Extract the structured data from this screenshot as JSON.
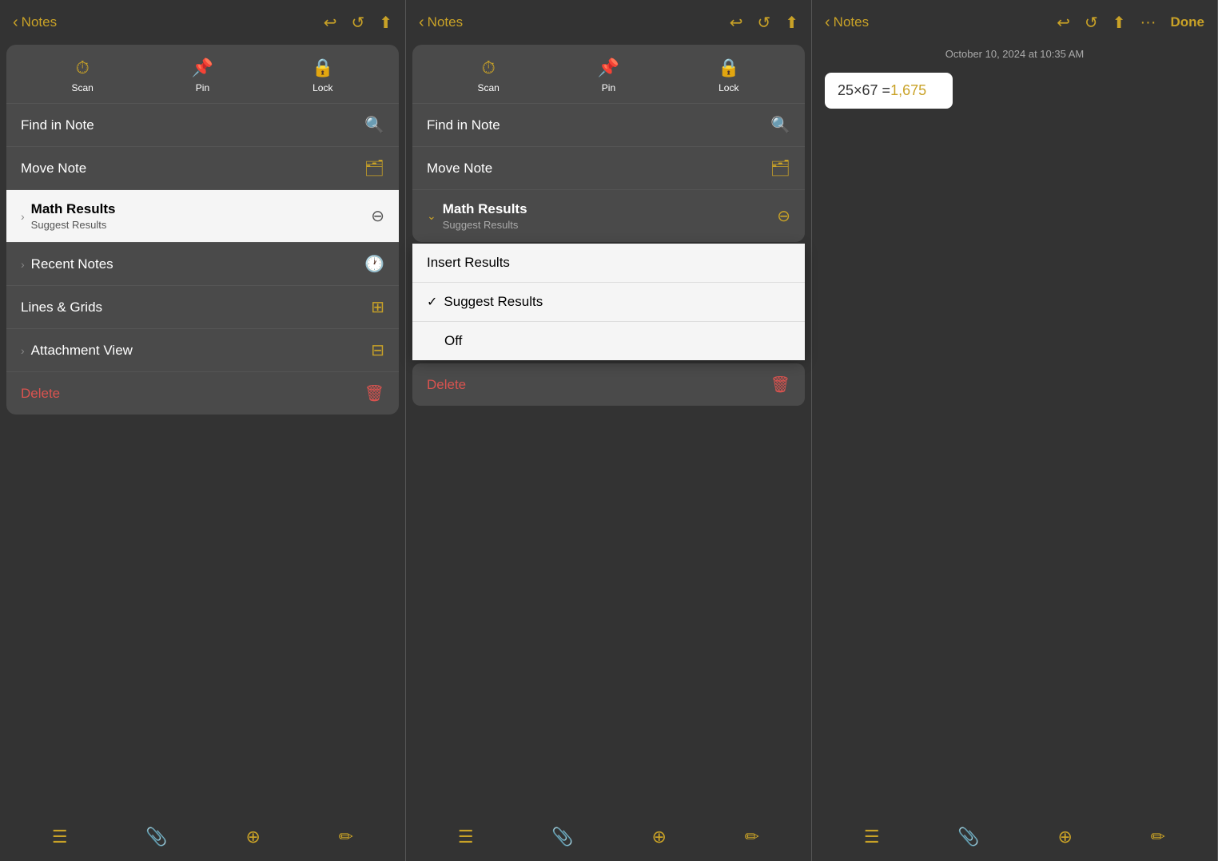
{
  "colors": {
    "accent": "#c9a227",
    "delete": "#d9534f",
    "bg": "#3a3a3a",
    "menuBg": "#4a4a4a",
    "white": "#ffffff",
    "lightGray": "#f5f5f5"
  },
  "panel1": {
    "nav": {
      "back_label": "Notes",
      "icons": [
        "↩",
        "↺",
        "⬆"
      ]
    },
    "tools": [
      {
        "icon": "⏱",
        "label": "Scan"
      },
      {
        "icon": "📌",
        "label": "Pin"
      },
      {
        "icon": "🔒",
        "label": "Lock"
      }
    ],
    "menu_items": [
      {
        "id": "find",
        "label": "Find in Note",
        "icon": "🔍",
        "chevron": false,
        "highlighted": false
      },
      {
        "id": "move",
        "label": "Move Note",
        "icon": "📁",
        "chevron": false,
        "highlighted": false
      },
      {
        "id": "math",
        "label": "Math Results",
        "sublabel": "Suggest Results",
        "icon": "⊖",
        "chevron": true,
        "highlighted": true
      },
      {
        "id": "recent",
        "label": "Recent Notes",
        "icon": "🕐",
        "chevron": true,
        "highlighted": false
      },
      {
        "id": "lines",
        "label": "Lines & Grids",
        "icon": "⊞",
        "chevron": false,
        "highlighted": false
      },
      {
        "id": "attach",
        "label": "Attachment View",
        "icon": "⊟",
        "chevron": true,
        "highlighted": false
      },
      {
        "id": "delete",
        "label": "Delete",
        "icon": "🗑",
        "chevron": false,
        "highlighted": false,
        "delete": true
      }
    ],
    "bottom_icons": [
      "☰",
      "📎",
      "⊕",
      "✏"
    ]
  },
  "panel2": {
    "nav": {
      "back_label": "Notes",
      "icons": [
        "↩",
        "↺",
        "⬆"
      ]
    },
    "tools": [
      {
        "icon": "⏱",
        "label": "Scan"
      },
      {
        "icon": "📌",
        "label": "Pin"
      },
      {
        "icon": "🔒",
        "label": "Lock"
      }
    ],
    "menu_items": [
      {
        "id": "find",
        "label": "Find in Note",
        "icon": "🔍",
        "chevron": false,
        "highlighted": false
      },
      {
        "id": "move",
        "label": "Move Note",
        "icon": "📁",
        "chevron": false,
        "highlighted": false
      },
      {
        "id": "math",
        "label": "Math Results",
        "sublabel": "Suggest Results",
        "icon": "⊖",
        "chevron_down": true,
        "highlighted": false
      }
    ],
    "submenu": [
      {
        "id": "insert",
        "label": "Insert Results",
        "checked": false
      },
      {
        "id": "suggest",
        "label": "Suggest Results",
        "checked": true
      },
      {
        "id": "off",
        "label": "Off",
        "checked": false
      }
    ],
    "menu_items_after": [
      {
        "id": "delete",
        "label": "Delete",
        "icon": "🗑",
        "delete": true
      }
    ],
    "bottom_icons": [
      "☰",
      "📎",
      "⊕",
      "✏"
    ]
  },
  "panel3": {
    "nav": {
      "back_label": "Notes",
      "icons": [
        "↩",
        "↺",
        "⬆",
        "···"
      ],
      "done_label": "Done"
    },
    "datetime": "October 10, 2024 at 10:35 AM",
    "equation": "25×67 =",
    "result": "1,675",
    "bottom_icons": [
      "☰",
      "📎",
      "⊕",
      "✏"
    ]
  }
}
